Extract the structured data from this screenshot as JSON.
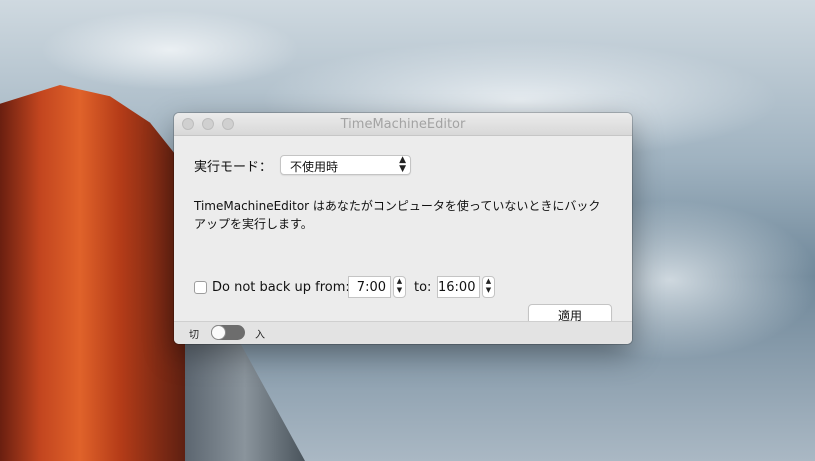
{
  "window": {
    "title": "TimeMachineEditor"
  },
  "mode": {
    "label": "実行モード：",
    "selected": "不使用時"
  },
  "description": "TimeMachineEditor はあなたがコンピュータを使っていないときにバックアップを実行します。",
  "schedule": {
    "checkbox_label": "Do not back up from:",
    "from": "7:00",
    "to_label": "to:",
    "to": "16:00",
    "checked": false
  },
  "apply_label": "適用",
  "footer": {
    "off_label": "切",
    "on_label": "入",
    "enabled": false
  }
}
